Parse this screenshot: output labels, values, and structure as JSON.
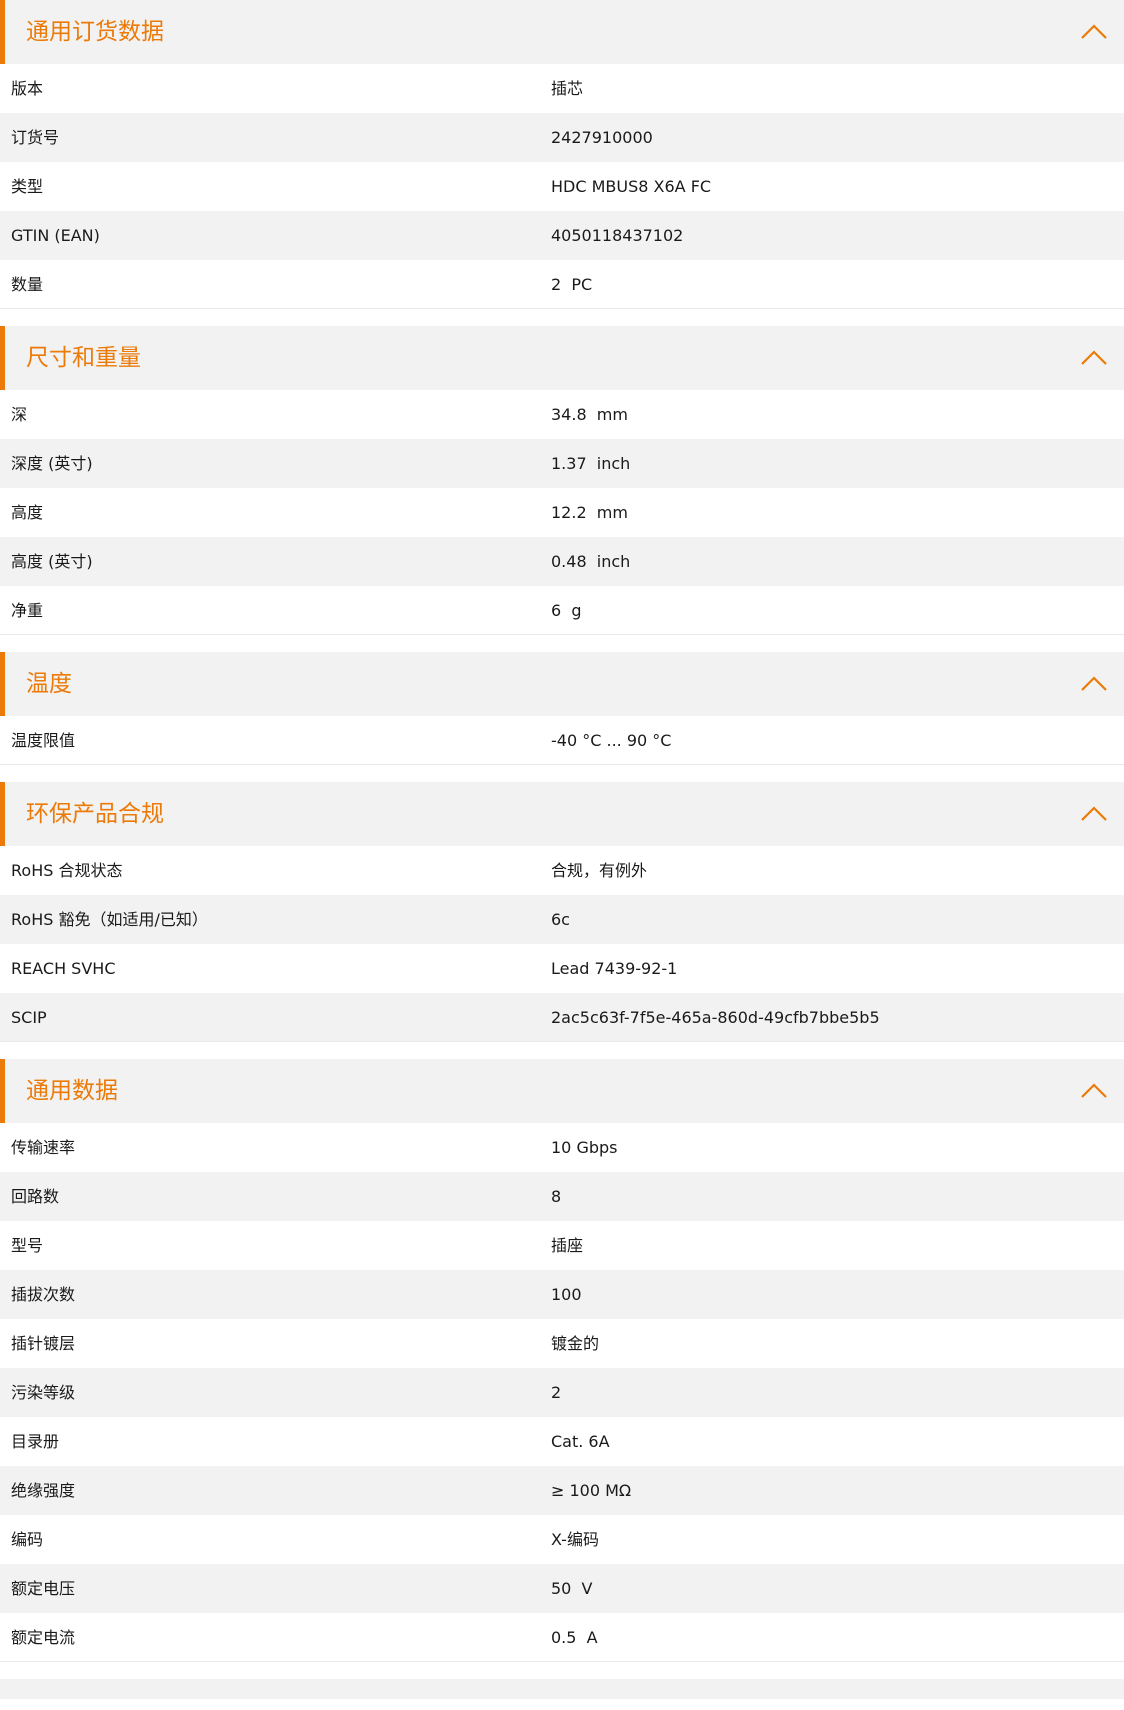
{
  "colors": {
    "accent": "#ec7a08",
    "row_alt": "#f2f2f2",
    "text": "#1a1a1a"
  },
  "icons": {
    "collapse": "chevron-up-icon"
  },
  "sections": [
    {
      "title": "通用订货数据",
      "rows": [
        {
          "label": "版本",
          "value": "插芯"
        },
        {
          "label": "订货号",
          "value": "2427910000"
        },
        {
          "label": "类型",
          "value": "HDC MBUS8 X6A FC"
        },
        {
          "label": "GTIN (EAN)",
          "value": "4050118437102"
        },
        {
          "label": "数量",
          "value": "2  PC"
        }
      ]
    },
    {
      "title": "尺寸和重量",
      "rows": [
        {
          "label": "深",
          "value": "34.8  mm"
        },
        {
          "label": "深度 (英寸)",
          "value": "1.37  inch"
        },
        {
          "label": "高度",
          "value": "12.2  mm"
        },
        {
          "label": "高度 (英寸)",
          "value": "0.48  inch"
        },
        {
          "label": "净重",
          "value": "6  g"
        }
      ]
    },
    {
      "title": "温度",
      "rows": [
        {
          "label": "温度限值",
          "value": "-40 °C ... 90 °C"
        }
      ]
    },
    {
      "title": "环保产品合规",
      "rows": [
        {
          "label": "RoHS 合规状态",
          "value": "合规，有例外"
        },
        {
          "label": "RoHS 豁免（如适用/已知）",
          "value": "6c"
        },
        {
          "label": "REACH SVHC",
          "value": "Lead 7439-92-1"
        },
        {
          "label": "SCIP",
          "value": "2ac5c63f-7f5e-465a-860d-49cfb7bbe5b5"
        }
      ]
    },
    {
      "title": "通用数据",
      "rows": [
        {
          "label": "传输速率",
          "value": "10 Gbps"
        },
        {
          "label": "回路数",
          "value": "8"
        },
        {
          "label": "型号",
          "value": "插座"
        },
        {
          "label": "插拔次数",
          "value": "100"
        },
        {
          "label": "插针镀层",
          "value": "镀金的"
        },
        {
          "label": "污染等级",
          "value": "2"
        },
        {
          "label": "目录册",
          "value": "Cat. 6A"
        },
        {
          "label": "绝缘强度",
          "value": "≥ 100 MΩ"
        },
        {
          "label": "编码",
          "value": "X-编码"
        },
        {
          "label": "额定电压",
          "value": "50  V"
        },
        {
          "label": "额定电流",
          "value": "0.5  A"
        }
      ]
    }
  ]
}
